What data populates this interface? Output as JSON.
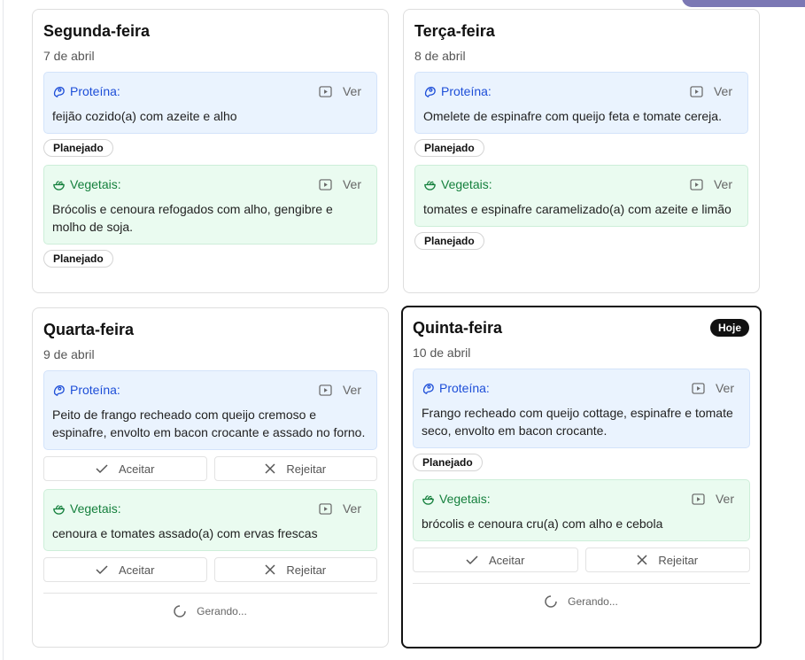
{
  "labels": {
    "protein": "Proteína:",
    "veg": "Vegetais:",
    "view": "Ver",
    "planned": "Planejado",
    "accept": "Aceitar",
    "reject": "Rejeitar",
    "generating": "Gerando...",
    "today": "Hoje"
  },
  "colors": {
    "protein_bg": "#eaf3fe",
    "protein_text": "#1d4ed8",
    "veg_bg": "#eafbf0",
    "veg_text": "#15803d"
  },
  "days": [
    {
      "name": "Segunda-feira",
      "date": "7 de abril",
      "protein": "feijão cozido(a) com azeite e alho",
      "veg": "Brócolis e cenoura refogados com alho, gengibre e molho de soja."
    },
    {
      "name": "Terça-feira",
      "date": "8 de abril",
      "protein": "Omelete de espinafre com queijo feta e tomate cereja.",
      "veg": "tomates e espinafre caramelizado(a) com azeite e limão"
    },
    {
      "name": "Quarta-feira",
      "date": "9 de abril",
      "protein": "Peito de frango recheado com queijo cremoso e espinafre, envolto em bacon crocante e assado no forno.",
      "veg": "cenoura e tomates assado(a) com ervas frescas"
    },
    {
      "name": "Quinta-feira",
      "date": "10 de abril",
      "protein": "Frango recheado com queijo cottage, espinafre e tomate seco, envolto em bacon crocante.",
      "veg": "brócolis e cenoura cru(a) com alho e cebola"
    }
  ]
}
